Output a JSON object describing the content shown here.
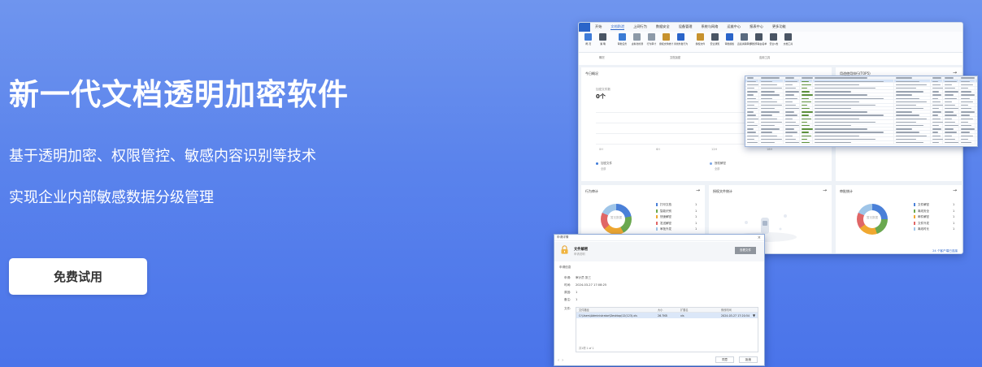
{
  "hero": {
    "title": "新一代文档透明加密软件",
    "line1": "基于透明加密、权限管控、敏感内容识别等技术",
    "line2": "实现企业内部敏感数据分级管理",
    "trial_button": "免费试用"
  },
  "app": {
    "menu": [
      "开始",
      "文档防泄",
      "上网行为",
      "数据安全",
      "设备管理",
      "系统与网络",
      "运维中心",
      "报表中心",
      "更多功能"
    ],
    "active_menu_index": 1,
    "ribbon": [
      {
        "label": "概 况",
        "color": "#3e7bd8"
      },
      {
        "label": "策 略",
        "color": "#4a5564"
      },
      {
        "label": "审批任务",
        "color": "#3a7bd5"
      },
      {
        "label": "虚拟化检测",
        "color": "#8d9aa8"
      },
      {
        "label": "行为审计",
        "color": "#8d9aa8"
      },
      {
        "label": "授权文件统计",
        "color": "#c7922e"
      },
      {
        "label": "离线外发行为",
        "color": "#2a64c9"
      },
      {
        "label": "授权文件",
        "color": "#c7922e"
      },
      {
        "label": "安全通知",
        "color": "#4a5564"
      },
      {
        "label": "审批模板",
        "color": "#2a64c9"
      },
      {
        "label": "直接关联审批",
        "color": "#5a6b80"
      },
      {
        "label": "网络传输白名单",
        "color": "#4a5564"
      },
      {
        "label": "安全U盘",
        "color": "#4a5564"
      },
      {
        "label": "文档工具",
        "color": "#4a5564"
      }
    ],
    "ribbon_groups": [
      "概况",
      "文档加密",
      "应用工具"
    ],
    "overview": {
      "title": "今日概况",
      "stat_label": "加密文件数",
      "stat_value": "0个",
      "x_ticks": [
        "0H",
        "6H",
        "12H",
        "18H"
      ],
      "legend": [
        {
          "label": "加密文件",
          "sub": "全部",
          "color": "#3e7bd8"
        },
        {
          "label": "授权解密",
          "sub": "全部",
          "color": "#7aa7e8"
        }
      ]
    },
    "top5_title": "用途使用排行(TOP5)",
    "behavior": {
      "title": "行为审计",
      "center": "暂无数据",
      "items": [
        {
          "label": "打印文档",
          "count": "1",
          "color": "#4a80d8"
        },
        {
          "label": "智能识别",
          "count": "1",
          "color": "#6aa84f"
        },
        {
          "label": "快速解密",
          "count": "1",
          "color": "#f0a830"
        },
        {
          "label": "发送解密",
          "count": "1",
          "color": "#e06666"
        },
        {
          "label": "审批外发",
          "count": "1",
          "color": "#9fc5e8"
        }
      ]
    },
    "authorized": {
      "title": "授权文件统计"
    },
    "approval": {
      "title": "审批统计",
      "center": "暂无数据",
      "items": [
        {
          "label": "文件解密",
          "count": "1",
          "color": "#4a80d8"
        },
        {
          "label": "离线安全",
          "count": "1",
          "color": "#6aa84f"
        },
        {
          "label": "邮件解密",
          "count": "1",
          "color": "#f0a830"
        },
        {
          "label": "文件外发",
          "count": "1",
          "color": "#e06666"
        },
        {
          "label": "离线时长",
          "count": "1",
          "color": "#9fc5e8"
        }
      ]
    },
    "status": "24 个客户端已连接"
  },
  "dialog": {
    "title": "申请详情",
    "file_name": "文件解密",
    "file_sub": "申请说明",
    "top_button": "查看文件",
    "section": "申请信息",
    "fields": [
      {
        "k": "申请:",
        "v": "审计员 张三"
      },
      {
        "k": "时间:",
        "v": "2024-03-27 17:08:25"
      },
      {
        "k": "原因:",
        "v": "1"
      },
      {
        "k": "备注:",
        "v": "1"
      }
    ],
    "files_label": "文件:",
    "file_columns": [
      "文件路径",
      "大小",
      "扩展名",
      "修改时间"
    ],
    "file_row": [
      "C:\\Users\\Administrator\\Desktop\\12(123).xls",
      "26.7KB",
      "xls",
      "2024-03-27 17:20:54"
    ],
    "pager": "共1项  1 of 1",
    "btn_ok": "同意",
    "btn_cancel": "拒绝"
  }
}
